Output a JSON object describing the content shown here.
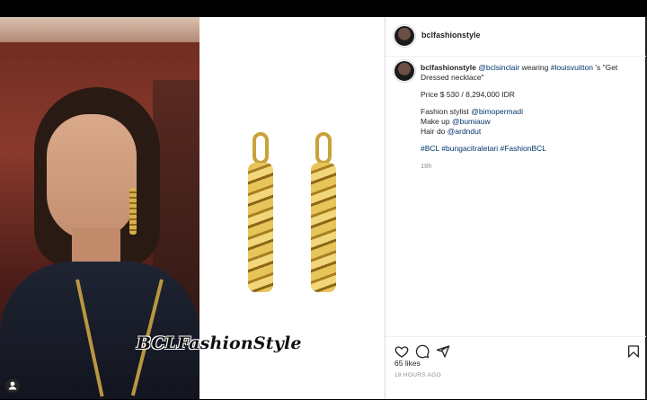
{
  "post": {
    "username": "bclfashionstyle",
    "caption": {
      "line1_mention": "@bclsinclair",
      "line1_text_a": " wearing ",
      "line1_hashtag": "#louisvuitton",
      "line1_text_b": " 's \"Get Dressed necklace\"",
      "price": "Price $ 530 / 8,294,000 IDR",
      "stylist_label": "Fashion stylist ",
      "stylist_handle": "@bimopermadi",
      "makeup_label": "Make up ",
      "makeup_handle": "@bumiauw",
      "hair_label": "Hair do ",
      "hair_handle": "@ardndut",
      "hashtags": "#BCL #bungacitraletari #FashionBCL",
      "age": "18h"
    },
    "likes": "65 likes",
    "posted": "18 HOURS AGO",
    "watermark": "BCLFashionStyle"
  },
  "icons": {
    "like": "heart-icon",
    "comment": "comment-icon",
    "share": "send-icon",
    "save": "bookmark-icon",
    "tag": "user-tag-icon"
  },
  "colors": {
    "link": "#00376b",
    "text": "#262626",
    "muted": "#8e8e8e",
    "gold": "#c9a23a"
  }
}
